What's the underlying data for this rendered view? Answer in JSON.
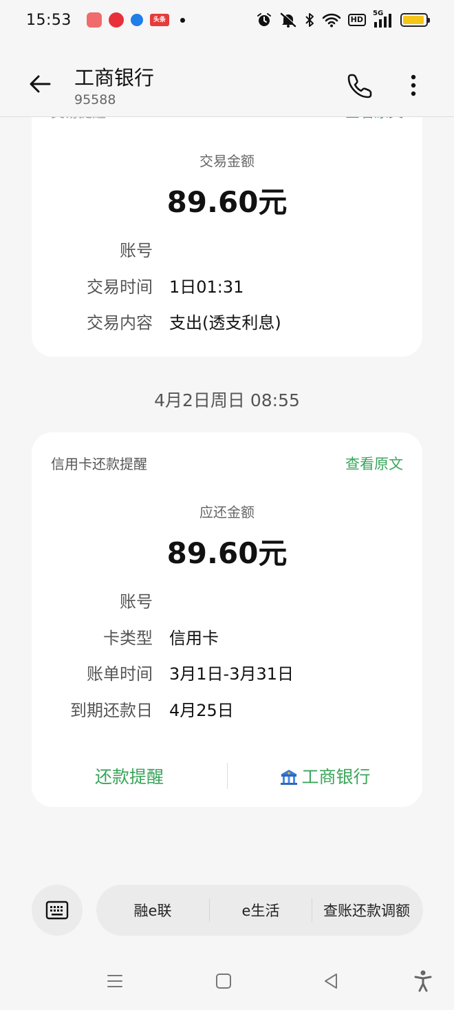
{
  "status_bar": {
    "time": "15:53",
    "app_badge_d": "头条",
    "network": "5G",
    "hd_label": "HD",
    "battery_level": 0.95,
    "icons": [
      "alarm-icon",
      "mute-icon",
      "bluetooth-icon",
      "wifi-icon",
      "signal-icon",
      "battery-icon"
    ]
  },
  "header": {
    "contact_name": "工商银行",
    "contact_number": "95588"
  },
  "messages": [
    {
      "clipped_type": "交易提醒",
      "clipped_view": "查看原文",
      "amount_label": "交易金额",
      "amount_value": "89.60元",
      "rows": [
        {
          "key": "账号",
          "value": ""
        },
        {
          "key": "交易时间",
          "value": "1日01:31"
        },
        {
          "key": "交易内容",
          "value": "支出(透支利息)"
        }
      ]
    },
    {
      "type_label": "信用卡还款提醒",
      "view_original": "查看原文",
      "amount_label": "应还金额",
      "amount_value": "89.60元",
      "rows": [
        {
          "key": "账号",
          "value": ""
        },
        {
          "key": "卡类型",
          "value": "信用卡"
        },
        {
          "key": "账单时间",
          "value": "3月1日-3月31日"
        },
        {
          "key": "到期还款日",
          "value": "4月25日"
        }
      ],
      "actions": {
        "left": "还款提醒",
        "right": "工商银行"
      }
    }
  ],
  "date_divider": "4月2日周日 08:55",
  "bottom_menu": {
    "items": [
      "融e联",
      "e生活",
      "查账还款调额"
    ]
  },
  "colors": {
    "accent_green": "#3aa55b",
    "background": "#f6f6f6",
    "card": "#ffffff"
  }
}
